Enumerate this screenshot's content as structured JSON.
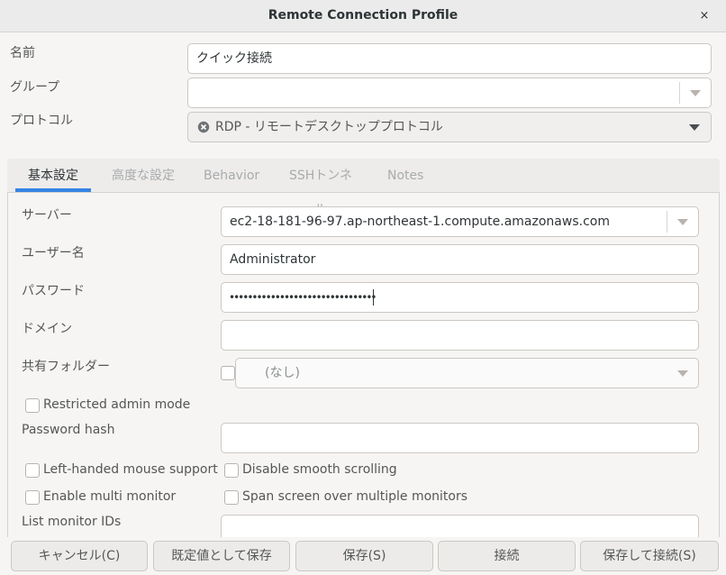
{
  "window": {
    "title": "Remote Connection Profile",
    "close_glyph": "×"
  },
  "profile": {
    "name_label": "名前",
    "name_value": "クイック接続",
    "group_label": "グループ",
    "group_value": "",
    "protocol_label": "プロトコル",
    "protocol_value": "RDP - リモートデスクトッププロトコル",
    "protocol_icon": "rdp-plugin-icon"
  },
  "tabs": [
    {
      "label": "基本設定",
      "active": true
    },
    {
      "label": "高度な設定",
      "active": false
    },
    {
      "label": "Behavior",
      "active": false
    },
    {
      "label": "SSHトンネル",
      "active": false
    },
    {
      "label": "Notes",
      "active": false
    }
  ],
  "basic": {
    "server_label": "サーバー",
    "server_value": "ec2-18-181-96-97.ap-northeast-1.compute.amazonaws.com",
    "username_label": "ユーザー名",
    "username_value": "Administrator",
    "password_label": "パスワード",
    "password_masked": "••••••••••••••••••••••••••••••••",
    "domain_label": "ドメイン",
    "domain_value": "",
    "shared_folder_label": "共有フォルダー",
    "shared_folder_value": "(なし)",
    "restricted_admin_label": "Restricted admin mode",
    "password_hash_label": "Password hash",
    "password_hash_value": "",
    "left_handed_label": "Left-handed mouse support",
    "disable_smooth_label": "Disable smooth scrolling",
    "multi_monitor_label": "Enable multi monitor",
    "span_screen_label": "Span screen over multiple monitors",
    "monitor_ids_label": "List monitor IDs",
    "monitor_ids_value": ""
  },
  "buttons": {
    "cancel": "キャンセル(C)",
    "save_default": "既定値として保存",
    "save": "保存(S)",
    "connect": "接続",
    "save_connect": "保存して接続(S)"
  },
  "colors": {
    "accent": "#3584e4",
    "window_bg": "#f6f5f4"
  }
}
